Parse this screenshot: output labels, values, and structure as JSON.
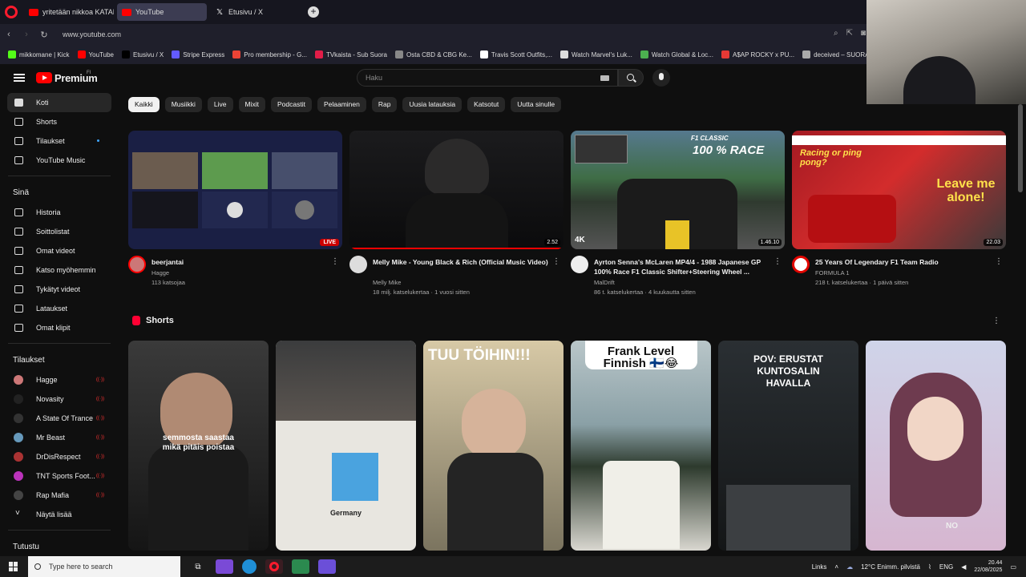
{
  "browser": {
    "tabs": [
      {
        "title": "yritetään nikkoa KATANA m",
        "active": false,
        "icon": "youtube-icon"
      },
      {
        "title": "YouTube",
        "active": true,
        "icon": "youtube-icon"
      },
      {
        "title": "Etusivu / X",
        "active": false,
        "icon": "x-icon"
      }
    ],
    "url": "www.youtube.com"
  },
  "bookmarks": [
    {
      "label": "mikkomane | Kick",
      "color": "#53fc18"
    },
    {
      "label": "YouTube",
      "color": "#ff0000"
    },
    {
      "label": "Etusivu / X",
      "color": "#000000"
    },
    {
      "label": "Stripe Express",
      "color": "#635bff"
    },
    {
      "label": "Pro membership - G...",
      "color": "#ea4335"
    },
    {
      "label": "TVkaista - Sub Suora",
      "color": "#e11d48"
    },
    {
      "label": "Osta CBD & CBG Ke...",
      "color": "#888888"
    },
    {
      "label": "Travis Scott Outfits,...",
      "color": "#ffffff"
    },
    {
      "label": "Watch Marvel's Luk...",
      "color": "#dddddd"
    },
    {
      "label": "Watch Global & Loc...",
      "color": "#4caf50"
    },
    {
      "label": "A$AP ROCKY x PU...",
      "color": "#e53935"
    },
    {
      "label": "deceived – SUORAT...",
      "color": "#aaaaaa"
    }
  ],
  "masthead": {
    "brand": "Premium",
    "brand_sup": "FI",
    "search_placeholder": "Haku"
  },
  "sidebar": {
    "main": [
      {
        "label": "Koti",
        "active": true,
        "icon": "home-icon"
      },
      {
        "label": "Shorts",
        "icon": "shorts-icon"
      },
      {
        "label": "Tilaukset",
        "icon": "subscriptions-icon",
        "dot": true
      },
      {
        "label": "YouTube Music",
        "icon": "music-icon"
      }
    ],
    "you_header": "Sinä",
    "you": [
      {
        "label": "Historia",
        "icon": "history-icon"
      },
      {
        "label": "Soittolistat",
        "icon": "playlists-icon"
      },
      {
        "label": "Omat videot",
        "icon": "your-videos-icon"
      },
      {
        "label": "Katso myöhemmin",
        "icon": "watch-later-icon"
      },
      {
        "label": "Tykätyt videot",
        "icon": "liked-icon"
      },
      {
        "label": "Lataukset",
        "icon": "download-icon"
      },
      {
        "label": "Omat klipit",
        "icon": "clips-icon"
      }
    ],
    "subs_header": "Tilaukset",
    "subs": [
      {
        "label": "Hagge",
        "color": "#c77"
      },
      {
        "label": "Novasity",
        "color": "#222"
      },
      {
        "label": "A State Of Trance",
        "color": "#333"
      },
      {
        "label": "Mr Beast",
        "color": "#69b"
      },
      {
        "label": "DrDisRespect",
        "color": "#a33"
      },
      {
        "label": "TNT Sports Foot...",
        "color": "#b3b"
      },
      {
        "label": "Rap Mafia",
        "color": "#444"
      }
    ],
    "show_more": "Näytä lisää",
    "explore_header": "Tutustu"
  },
  "chips": [
    "Kaikki",
    "Musiikki",
    "Live",
    "Mixit",
    "Podcastit",
    "Pelaaminen",
    "Rap",
    "Uusia latauksia",
    "Katsotut",
    "Uutta sinulle"
  ],
  "videos": [
    {
      "title": "beerjantai",
      "channel": "Hagge",
      "meta": "113 katsojaa",
      "badge": "LIVE",
      "live": true
    },
    {
      "title": "Melly Mike - Young Black & Rich (Official Music Video)",
      "channel": "Melly Mike",
      "meta": "18 milj. katselukertaa · 1 vuosi sitten",
      "badge": "2.52",
      "progress": 1.0
    },
    {
      "title": "Ayrton Senna's McLaren MP4/4 - 1988 Japanese GP 100% Race F1 Classic Shifter+Steering Wheel ...",
      "channel": "MalDrift",
      "meta": "86 t. katselukertaa · 4 kuukautta sitten",
      "badge": "1.46.10",
      "thumb_text": "100 % RACE",
      "thumb_brand": "F1 CLASSIC",
      "quality": "4K"
    },
    {
      "title": "25 Years Of Legendary F1 Team Radio",
      "channel": "FORMULA 1",
      "meta": "218 t. katselukertaa · 1 päivä sitten",
      "badge": "22.03",
      "thumb_text": "Leave me alone!",
      "thumb_text2": "Racing or ping pong?"
    }
  ],
  "shorts": {
    "title": "Shorts",
    "items": [
      {
        "caption": "semmosta saastaa mikä pitäis poistaa"
      },
      {
        "caption": "Germany"
      },
      {
        "caption": "TUU TÖIHIN!!!"
      },
      {
        "caption": "Frank Level Finnish 🇫🇮😂"
      },
      {
        "caption": "POV: ERUSTAT KUNTOSALIN HAVALLA"
      },
      {
        "caption": "NO"
      }
    ]
  },
  "taskbar": {
    "search_placeholder": "Type here to search",
    "links": "Links",
    "weather": "12°C  Enimm. pilvistä",
    "lang": "ENG",
    "time": "20.44",
    "date": "22/08/2025"
  }
}
